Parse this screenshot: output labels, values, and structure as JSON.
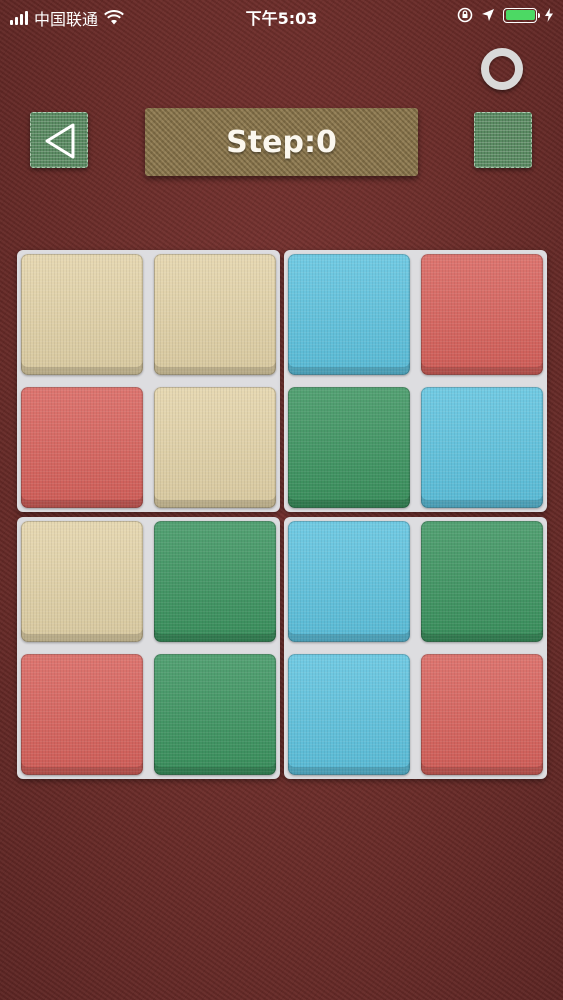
{
  "status_bar": {
    "carrier": "中国联通",
    "time": "下午5:03"
  },
  "controls": {
    "back_icon": "triangle-left-icon",
    "settings_icon": "ring-icon"
  },
  "header": {
    "step_label": "Step:0"
  },
  "colors": {
    "beige": "#e3d3a8",
    "red": "#d8625c",
    "blue": "#5ec3df",
    "green": "#3c9460"
  },
  "board": {
    "quadrants": [
      [
        "beige",
        "beige",
        "red",
        "beige"
      ],
      [
        "blue",
        "red",
        "green",
        "blue"
      ],
      [
        "beige",
        "green",
        "red",
        "green"
      ],
      [
        "blue",
        "green",
        "blue",
        "red"
      ]
    ]
  }
}
